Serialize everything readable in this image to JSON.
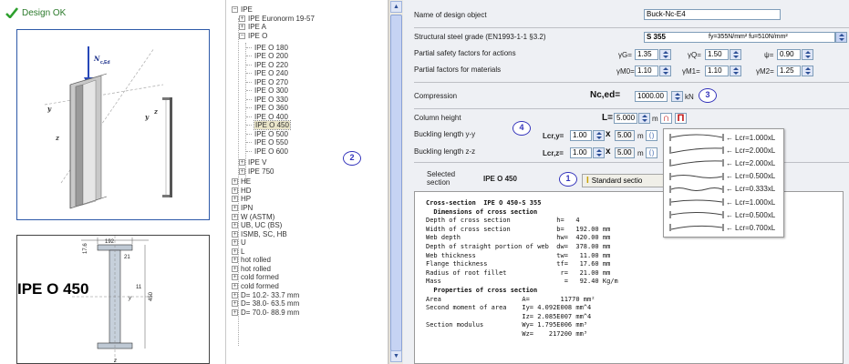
{
  "status": {
    "text": "Design OK"
  },
  "left_panel": {
    "view3d": {
      "load_label": "N",
      "load_sub": "c,Ed",
      "axis_y1": "y",
      "axis_y2": "y",
      "axis_z1": "z",
      "axis_z2": "z"
    },
    "view2d": {
      "title": "IPE O 450",
      "dim_width": "192",
      "dim_flange": "17.6",
      "dim_radius": "21",
      "dim_web": "11",
      "dim_height": "450",
      "axis_y": "y",
      "axis_z": "z"
    }
  },
  "tree": {
    "items": [
      {
        "label": "IPE",
        "box": "−"
      },
      {
        "label": "IPE  Euronorm 19-57",
        "box": "+"
      },
      {
        "label": "IPE A",
        "box": "+"
      },
      {
        "label": "IPE O",
        "box": "−"
      },
      {
        "label": "IPE O 180"
      },
      {
        "label": "IPE O 200"
      },
      {
        "label": "IPE O 220"
      },
      {
        "label": "IPE O 240"
      },
      {
        "label": "IPE O 270"
      },
      {
        "label": "IPE O 300"
      },
      {
        "label": "IPE O 330"
      },
      {
        "label": "IPE O 360"
      },
      {
        "label": "IPE O 400"
      },
      {
        "label": "IPE O 450"
      },
      {
        "label": "IPE O 500"
      },
      {
        "label": "IPE O 550"
      },
      {
        "label": "IPE O 600"
      },
      {
        "label": "IPE V",
        "box": "+"
      },
      {
        "label": "IPE 750",
        "box": "+"
      },
      {
        "label": "HE",
        "box": "+"
      },
      {
        "label": "HD",
        "box": "+"
      },
      {
        "label": "HP",
        "box": "+"
      },
      {
        "label": "IPN",
        "box": "+"
      },
      {
        "label": "W (ASTM)",
        "box": "+"
      },
      {
        "label": "UB, UC (BS)",
        "box": "+"
      },
      {
        "label": "ISMB, SC, HB",
        "box": "+"
      },
      {
        "label": "U",
        "box": "+"
      },
      {
        "label": "L",
        "box": "+"
      },
      {
        "label": "hot rolled",
        "box": "+"
      },
      {
        "label": "hot rolled",
        "box": "+"
      },
      {
        "label": "cold formed",
        "box": "+"
      },
      {
        "label": "cold formed",
        "box": "+"
      },
      {
        "label": "D= 10.2- 33.7 mm",
        "box": "+"
      },
      {
        "label": "D= 38.0- 63.5 mm",
        "box": "+"
      },
      {
        "label": "D= 70.0- 88.9 mm",
        "box": "+"
      }
    ],
    "marker": "2"
  },
  "form": {
    "name_label": "Name of design object",
    "name_value": "Buck-Nc-E4",
    "grade_label": "Structural steel grade (EN1993-1-1 §3.2)",
    "grade_value": "S 355",
    "grade_props": "fy=355N/mm²  fu=510N/mm²",
    "psf_label": "Partial safety factors for actions",
    "gammaG_sym": "γG=",
    "gammaG": "1.35",
    "gammaQ_sym": "γQ=",
    "gammaQ": "1.50",
    "psi_sym": "ψ=",
    "psi": "0.90",
    "pfm_label": "Partial factors for materials",
    "gM0_sym": "γM0=",
    "gM0": "1.10",
    "gM1_sym": "γM1=",
    "gM1": "1.10",
    "gM2_sym": "γM2=",
    "gM2": "1.25",
    "compression_label": "Compression",
    "ned_sym": "Nc,ed=",
    "ned_value": "1000.00",
    "ned_unit": "kN",
    "marker3": "3",
    "col_height_label": "Column height",
    "L_sym": "L=",
    "L_value": "5.000",
    "L_unit": "m",
    "marker4": "4",
    "bly_label": "Buckling length y-y",
    "lcry_sym": "Lcr,y=",
    "lcry_factor": "1.00",
    "lcry_len": "5.00",
    "lcry_unit": "m",
    "blz_label": "Buckling length z-z",
    "lcrz_sym": "Lcr,z=",
    "lcrz_factor": "1.00",
    "lcrz_len": "5.00",
    "lcrz_unit": "m",
    "mult_sym": "x",
    "selected_label": "Selected",
    "section_label": "section",
    "selected_value": "IPE O 450",
    "marker1": "1",
    "std_button": "Standard sectio"
  },
  "popup": {
    "items": [
      "Lcr=1.000xL",
      "Lcr=2.000xL",
      "Lcr=2.000xL",
      "Lcr=0.500xL",
      "Lcr=0.333xL",
      "Lcr=1.000xL",
      "Lcr=0.500xL",
      "Lcr=0.700xL"
    ]
  },
  "output": {
    "lines": [
      {
        "t": "Cross-section  IPE O 450-S 355",
        "b": true
      },
      {
        "t": "  Dimensions of cross section",
        "b": true
      },
      {
        "t": "Depth of cross section            h=   4"
      },
      {
        "t": "Width of cross section            b=   192.00 mm"
      },
      {
        "t": "Web depth                         hw=  420.00 mm"
      },
      {
        "t": "Depth of straight portion of web  dw=  378.00 mm"
      },
      {
        "t": "Web thickness                     tw=   11.00 mm"
      },
      {
        "t": "Flange thickness                  tf=   17.60 mm"
      },
      {
        "t": "Radius of root fillet              r=   21.00 mm"
      },
      {
        "t": "Mass                                =   92.40 Kg/m"
      },
      {
        "t": "  Properties of cross section",
        "b": true
      },
      {
        "t": "Area                     A=        11770 mm²"
      },
      {
        "t": "Second moment of area    Iy= 4.092E008 mm^4"
      },
      {
        "t": "                         Iz= 2.085E007 mm^4"
      },
      {
        "t": "Section modulus          Wy= 1.795E006 mm³"
      },
      {
        "t": "                         Wz=    217200 mm³"
      }
    ]
  }
}
